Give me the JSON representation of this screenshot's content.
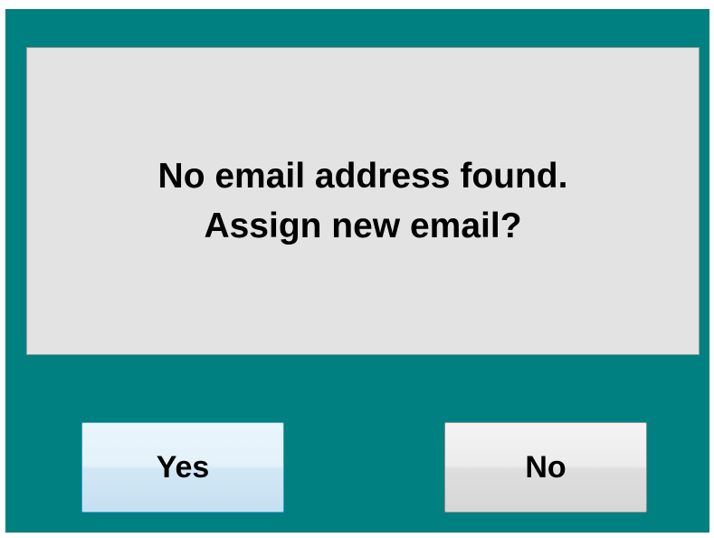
{
  "dialog": {
    "message_line1": "No email address found.",
    "message_line2": "Assign new email?",
    "yes_label": "Yes",
    "no_label": "No"
  },
  "colors": {
    "background": "#008080",
    "panel": "#e3e3e3",
    "focus_border": "#3c9fd8"
  }
}
